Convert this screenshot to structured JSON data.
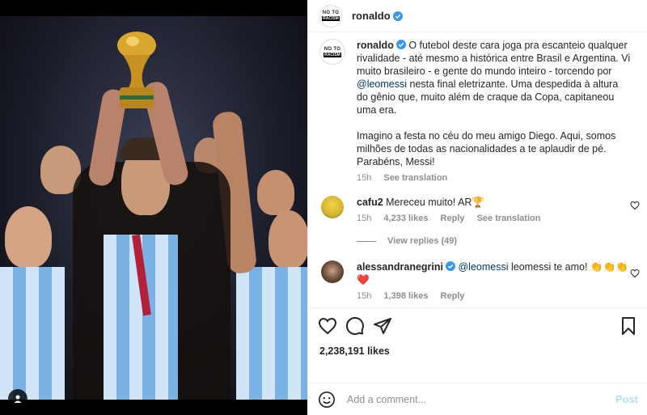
{
  "post": {
    "username": "ronaldo",
    "avatar_text_line1": "NO TO",
    "avatar_text_line2": "RACISM",
    "caption_p1_before": " O futebol deste cara joga pra escanteio qualquer rivalidade - até mesmo a histórica entre Brasil e Argentina. Vi muito brasileiro - e gente do mundo inteiro - torcendo por ",
    "caption_mention": "@leomessi",
    "caption_p1_after": " nesta final eletrizante. Uma despedida à altura do gênio que, muito além de craque da Copa, capitaneou uma era.",
    "caption_p2": "Imagino a festa no céu do meu amigo Diego. Aqui, somos milhões de todas as nacionalidades a te aplaudir de pé. Parabéns, Messi!",
    "time": "15h",
    "see_translation": "See translation"
  },
  "comments": [
    {
      "username": "cafu2",
      "text": "Mereceu muito! AR🏆",
      "time": "15h",
      "likes": "4,233 likes",
      "reply": "Reply",
      "see_translation": "See translation",
      "view_replies": "View replies (49)"
    },
    {
      "username": "alessandranegrini",
      "mention": "@leomessi",
      "text": " leomessi te amo! 👏👏👏❤️",
      "time": "15h",
      "likes": "1,398 likes",
      "reply": "Reply"
    }
  ],
  "likes_count": "2,238,191 likes",
  "add_comment_placeholder": "Add a comment...",
  "post_button": "Post",
  "icons": {
    "like": "heart-icon",
    "comment": "comment-icon",
    "share": "share-icon",
    "save": "bookmark-icon",
    "emoji": "emoji-icon",
    "tag": "user-tag-icon",
    "verified": "verified-badge-icon"
  },
  "colors": {
    "verified": "#3897f0",
    "mention": "#00376b",
    "post_button": "#b2dffc",
    "secondary_text": "#8e8e8e"
  }
}
